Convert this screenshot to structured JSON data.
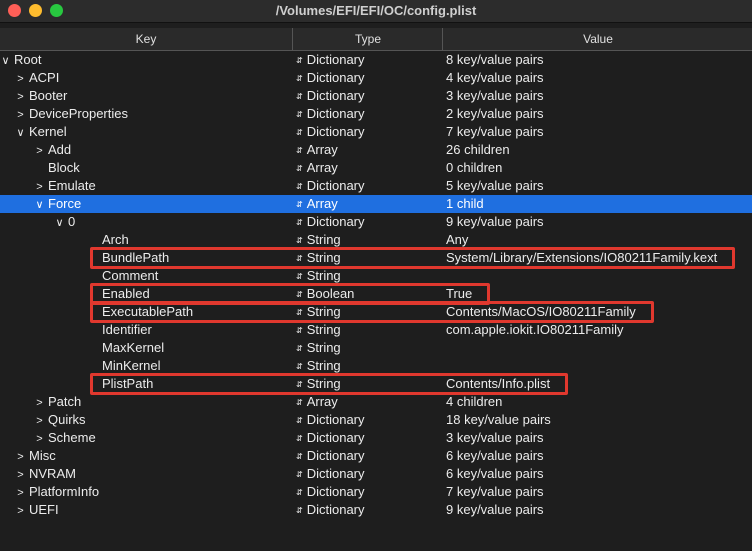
{
  "window": {
    "title": "/Volumes/EFI/EFI/OC/config.plist"
  },
  "columns": {
    "key": "Key",
    "type": "Type",
    "value": "Value"
  },
  "rows": [
    {
      "key": "Root",
      "type": "Dictionary",
      "value": "8 key/value pairs",
      "depth": 0,
      "disc": "open"
    },
    {
      "key": "ACPI",
      "type": "Dictionary",
      "value": "4 key/value pairs",
      "depth": 1,
      "disc": "closed"
    },
    {
      "key": "Booter",
      "type": "Dictionary",
      "value": "3 key/value pairs",
      "depth": 1,
      "disc": "closed"
    },
    {
      "key": "DeviceProperties",
      "type": "Dictionary",
      "value": "2 key/value pairs",
      "depth": 1,
      "disc": "closed"
    },
    {
      "key": "Kernel",
      "type": "Dictionary",
      "value": "7 key/value pairs",
      "depth": 1,
      "disc": "open"
    },
    {
      "key": "Add",
      "type": "Array",
      "value": "26 children",
      "depth": 2,
      "disc": "closed"
    },
    {
      "key": "Block",
      "type": "Array",
      "value": "0 children",
      "depth": 2,
      "disc": "none"
    },
    {
      "key": "Emulate",
      "type": "Dictionary",
      "value": "5 key/value pairs",
      "depth": 2,
      "disc": "closed"
    },
    {
      "key": "Force",
      "type": "Array",
      "value": "1 child",
      "depth": 2,
      "disc": "open",
      "selected": true
    },
    {
      "key": "0",
      "type": "Dictionary",
      "value": "9 key/value pairs",
      "depth": 3,
      "disc": "open"
    },
    {
      "key": "Arch",
      "type": "String",
      "value": "Any",
      "depth": 4,
      "disc": "none"
    },
    {
      "key": "BundlePath",
      "type": "String",
      "value": "System/Library/Extensions/IO80211Family.kext",
      "depth": 4,
      "disc": "none"
    },
    {
      "key": "Comment",
      "type": "String",
      "value": "",
      "depth": 4,
      "disc": "none"
    },
    {
      "key": "Enabled",
      "type": "Boolean",
      "value": "True",
      "depth": 4,
      "disc": "none"
    },
    {
      "key": "ExecutablePath",
      "type": "String",
      "value": "Contents/MacOS/IO80211Family",
      "depth": 4,
      "disc": "none"
    },
    {
      "key": "Identifier",
      "type": "String",
      "value": "com.apple.iokit.IO80211Family",
      "depth": 4,
      "disc": "none"
    },
    {
      "key": "MaxKernel",
      "type": "String",
      "value": "",
      "depth": 4,
      "disc": "none"
    },
    {
      "key": "MinKernel",
      "type": "String",
      "value": "",
      "depth": 4,
      "disc": "none"
    },
    {
      "key": "PlistPath",
      "type": "String",
      "value": "Contents/Info.plist",
      "depth": 4,
      "disc": "none"
    },
    {
      "key": "Patch",
      "type": "Array",
      "value": "4 children",
      "depth": 2,
      "disc": "closed"
    },
    {
      "key": "Quirks",
      "type": "Dictionary",
      "value": "18 key/value pairs",
      "depth": 2,
      "disc": "closed"
    },
    {
      "key": "Scheme",
      "type": "Dictionary",
      "value": "3 key/value pairs",
      "depth": 2,
      "disc": "closed"
    },
    {
      "key": "Misc",
      "type": "Dictionary",
      "value": "6 key/value pairs",
      "depth": 1,
      "disc": "closed"
    },
    {
      "key": "NVRAM",
      "type": "Dictionary",
      "value": "6 key/value pairs",
      "depth": 1,
      "disc": "closed"
    },
    {
      "key": "PlatformInfo",
      "type": "Dictionary",
      "value": "7 key/value pairs",
      "depth": 1,
      "disc": "closed"
    },
    {
      "key": "UEFI",
      "type": "Dictionary",
      "value": "9 key/value pairs",
      "depth": 1,
      "disc": "closed"
    }
  ],
  "annotations": {
    "color": "#e0382e",
    "highlighted_keys": [
      "BundlePath",
      "Enabled",
      "ExecutablePath",
      "PlistPath"
    ]
  },
  "colors": {
    "selection": "#1f6fe0",
    "background": "#1e1e1e"
  }
}
